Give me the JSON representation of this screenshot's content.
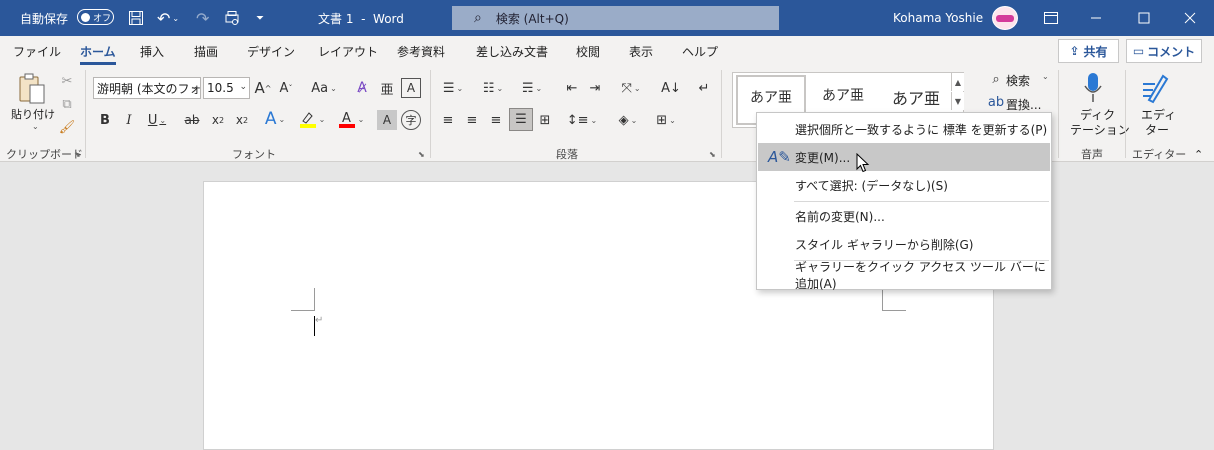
{
  "titlebar": {
    "autosave_label": "自動保存",
    "toggle_state": "オフ",
    "doc_title": "文書 1  -  Word",
    "search_placeholder": "検索 (Alt+Q)",
    "user_name": "Kohama Yoshie"
  },
  "tabs": [
    "ファイル",
    "ホーム",
    "挿入",
    "描画",
    "デザイン",
    "レイアウト",
    "参考資料",
    "差し込み文書",
    "校閲",
    "表示",
    "ヘルプ"
  ],
  "active_tab": "ホーム",
  "header_buttons": {
    "share": "共有",
    "comment": "コメント"
  },
  "ribbon": {
    "clipboard": {
      "paste_label": "貼り付け",
      "group_label": "クリップボード"
    },
    "font": {
      "font_name": "游明朝 (本文のフォ",
      "font_size": "10.5",
      "case_label": "Aa",
      "group_label": "フォント"
    },
    "paragraph": {
      "group_label": "段落"
    },
    "styles": {
      "items": [
        "あア亜",
        "あア亜",
        "あア亜"
      ]
    },
    "editing": {
      "find_label": "検索",
      "replace_label": "置換..."
    },
    "voice": {
      "dictate_label_1": "ディク",
      "dictate_label_2": "テーション",
      "group_label": "音声"
    },
    "editor": {
      "label_1": "エディ",
      "label_2": "ター",
      "group_label": "エディター"
    }
  },
  "context_menu": {
    "items": [
      "選択個所と一致するように 標準 を更新する(P)",
      "変更(M)...",
      "すべて選択: (データなし)(S)",
      "名前の変更(N)...",
      "スタイル ギャラリーから削除(G)",
      "ギャラリーをクイック アクセス ツール バーに追加(A)"
    ],
    "hovered_index": 1
  },
  "colors": {
    "title_bar": "#2b579a",
    "ribbon_bg": "#f3f2f1",
    "highlight": "#ffff00",
    "font_color": "#ff0000",
    "menu_hover": "#c8c8c8"
  }
}
